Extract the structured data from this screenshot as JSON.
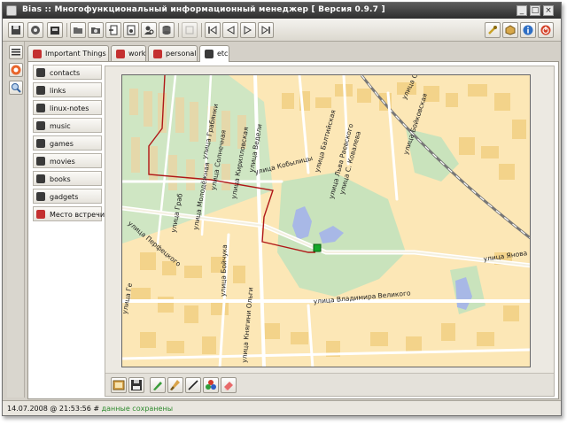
{
  "window": {
    "title": "Bias :: Многофункциональный информационный менеджер [ Версия 0.9.7 ]"
  },
  "title_buttons": [
    "minimize",
    "maximize",
    "close"
  ],
  "toolbar": {
    "left_icons": [
      "save-icon",
      "settings-icon",
      "export-icon",
      "open-folder-icon",
      "photo-folder-icon",
      "arrow-into-document-icon",
      "document-gear-icon",
      "search-person-icon",
      "database-icon"
    ],
    "mid_icons": [
      "disabled-icon",
      "first-icon",
      "back-icon",
      "forward-icon",
      "last-icon"
    ],
    "right_icons": [
      "wrench-icon",
      "package-icon",
      "info-icon",
      "power-icon"
    ]
  },
  "leftbar": {
    "icons": [
      "list-icon",
      "google-icon",
      "magnifier-icon"
    ]
  },
  "tabs": [
    {
      "label": "Important Things",
      "icon": "bookmark-icon",
      "color": "#c43030",
      "active": false
    },
    {
      "label": "work",
      "icon": "document-icon",
      "color": "#c43030",
      "active": false
    },
    {
      "label": "personal",
      "icon": "person-icon",
      "color": "#c43030",
      "active": false
    },
    {
      "label": "etc",
      "icon": "notes-icon",
      "color": "#3a3a3a",
      "active": true
    }
  ],
  "nav": {
    "items": [
      {
        "label": "contacts",
        "icon": "contacts-icon"
      },
      {
        "label": "links",
        "icon": "link-arrow-icon"
      },
      {
        "label": "linux-notes",
        "icon": "note-icon"
      },
      {
        "label": "music",
        "icon": "music-icon"
      },
      {
        "label": "games",
        "icon": "gamepad-icon"
      },
      {
        "label": "movies",
        "icon": "movie-icon"
      },
      {
        "label": "books",
        "icon": "book-icon"
      },
      {
        "label": "gadgets",
        "icon": "check-icon"
      },
      {
        "label": "Место встречи",
        "icon": "meeting-icon",
        "color": "#c43030"
      }
    ]
  },
  "map": {
    "streets": [
      "улица Грабянки",
      "улица Молодёжная",
      "улица Солнечная",
      "улица Кирилловская",
      "улица Ведели",
      "улица Кобылицы",
      "улица Балтийская",
      "улица Льва Раевского",
      "улица С. Ковалева",
      "улица Бойковская",
      "улица Сме",
      "улица Перфецкого",
      "улица Бойчука",
      "улица Янова",
      "улица Владимира Великого",
      "улица Княгини Ольги",
      "улица Граб",
      "улица Ге"
    ]
  },
  "bottombar": {
    "icons": [
      "image-icon",
      "floppy-icon",
      "pencil-icon",
      "brush-icon",
      "line-icon",
      "palette-icon",
      "eraser-icon"
    ]
  },
  "status": {
    "datetime": "14.07.2008 @ 21:53:56",
    "hash": "#",
    "message": "данные сохранены"
  }
}
